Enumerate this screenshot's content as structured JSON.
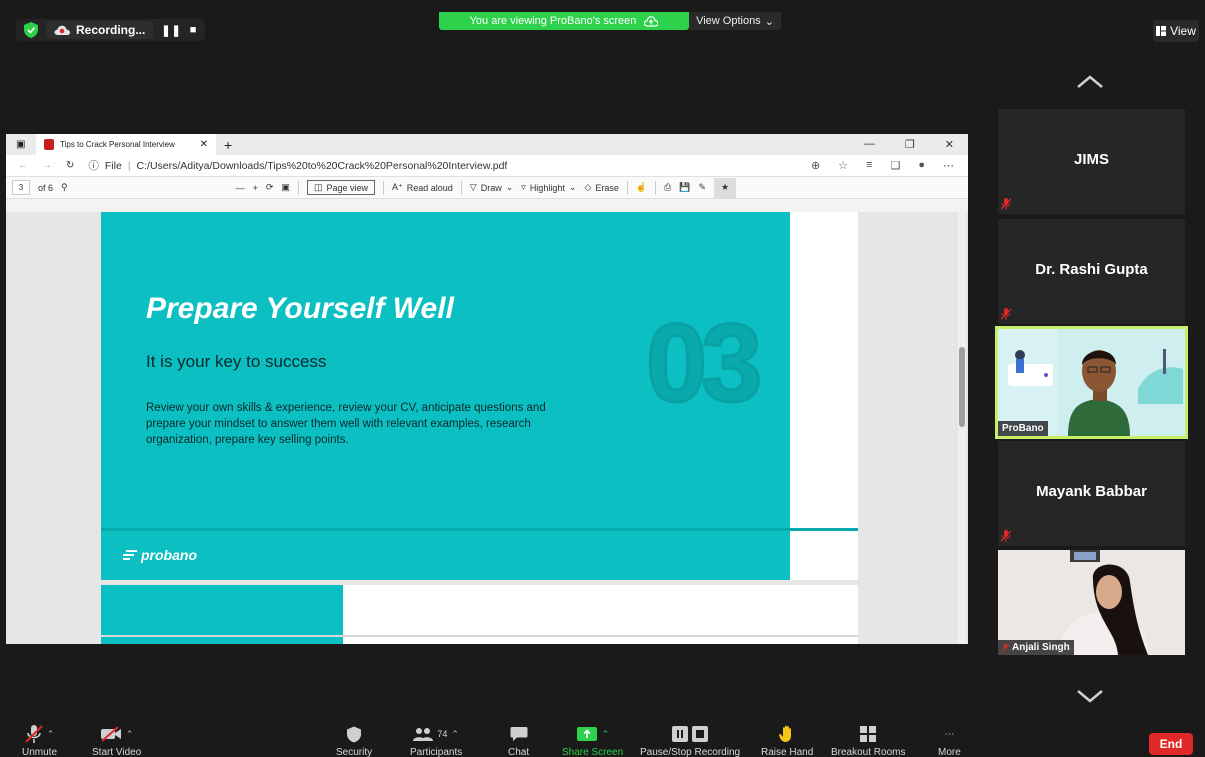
{
  "top": {
    "recording_label": "Recording...",
    "viewing_banner": "You are viewing ProBano's screen",
    "view_options_label": "View Options",
    "view_label": "View"
  },
  "browser": {
    "tab_title": "Tips to Crack Personal Interview",
    "new_tab": "+",
    "file_label": "File",
    "url": "C:/Users/Aditya/Downloads/Tips%20to%20Crack%20Personal%20Interview.pdf",
    "page_number": "3",
    "page_total": "of 6",
    "page_view_label": "Page view",
    "read_aloud_label": "Read aloud",
    "draw_label": "Draw",
    "highlight_label": "Highlight",
    "erase_label": "Erase"
  },
  "slide": {
    "title": "Prepare Yourself Well",
    "subtitle": "It is your key to success",
    "body": "Review your own skills & experience, review your CV, anticipate questions and prepare your mindset to answer them well with relevant examples, research organization, prepare key selling points.",
    "number": "03",
    "logo_text": "probano"
  },
  "participants": {
    "tiles": [
      {
        "name": "JIMS"
      },
      {
        "name": "Dr. Rashi Gupta"
      },
      {
        "name": "ProBano"
      },
      {
        "name": "Mayank Babbar"
      },
      {
        "name": "Anjali Singh"
      }
    ]
  },
  "toolbar": {
    "unmute": "Unmute",
    "start_video": "Start Video",
    "security": "Security",
    "participants": "Participants",
    "participants_count": "74",
    "chat": "Chat",
    "share_screen": "Share Screen",
    "pause_stop_recording": "Pause/Stop Recording",
    "raise_hand": "Raise Hand",
    "breakout_rooms": "Breakout Rooms",
    "more": "More",
    "end": "End"
  },
  "colors": {
    "teal": "#0bbfc2",
    "banner_green": "#2dd14b",
    "end_red": "#e02828",
    "active_speaker": "#c8ef6a"
  }
}
